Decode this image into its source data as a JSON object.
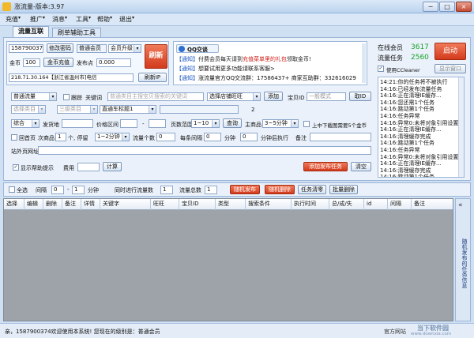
{
  "window": {
    "title": "涨流量-版本:3.97",
    "minimize": "−",
    "maximize": "□",
    "close": "×"
  },
  "menu": [
    "充值",
    "推广",
    "消息",
    "工具",
    "帮助",
    "退出"
  ],
  "tabs": [
    "流量互联",
    "刷单辅助工具"
  ],
  "account": {
    "id": "1587900374",
    "change_pwd": "修改密码",
    "member_type": "普通会员",
    "upgrade": "会员升级",
    "gold_label": "金币",
    "gold_value": "100",
    "gold_recharge": "金币充值",
    "points_label": "发布点",
    "points_value": "0.000",
    "refresh": "刷新",
    "ip": "218.71.30.164【浙江省温州市]电信",
    "refresh_ip": "刷新IP"
  },
  "qq": {
    "title": "QQ交谈",
    "notices": [
      {
        "tag": "【通知】",
        "pre": "付费会员每天请到",
        "red": "充值菜单里的礼包",
        "post": "领取金币!"
      },
      {
        "tag": "【通知】",
        "pre": "想要试用更多功能请联系客服>",
        "red": "",
        "post": ""
      },
      {
        "tag": "【通知】",
        "pre": "涨流量官方QQ交流群：17586437+  商家互助群：332616029",
        "red": "",
        "post": ""
      }
    ]
  },
  "stats": {
    "online_label": "在线会员",
    "online_value": "3617",
    "tasks_label": "流量任务",
    "tasks_value": "2560",
    "start": "启动",
    "ccleaner": "使用CCleaner",
    "show_window": "显示窗口"
  },
  "form": {
    "flow_type": "普通流量",
    "shop_check": "跟踪",
    "keyword_label": "关键词",
    "keyword_placeholder": "普通类目主搜宝贝搜索的关键词",
    "shop_select": "选择店铺旺旺",
    "add": "添加",
    "item_id_label": "宝贝ID",
    "item_id_placeholder": "一般模式",
    "get_id": "取ID",
    "cat1": "选择类目",
    "cat2": "三级类目",
    "title_label": "直通车标题1",
    "page_num": "2",
    "sort": "综合",
    "ship_label": "发货地",
    "price_label": "价格区间",
    "price_dash": "-",
    "pages_label": "页数范围",
    "pages_value": "1~10",
    "query": "查询",
    "main_label": "主商品",
    "main_value": "3~5分钟",
    "top_check": "上中下截图需要5个金币",
    "home_check": "回首页",
    "sub_label": "次商品",
    "sub_count": "1",
    "sub_unit": "个, 停留",
    "sub_stay": "1~2分钟",
    "flow_count_label": "流量个数",
    "flow_count": "0",
    "interval_label": "每条间隔",
    "interval_val": "0",
    "min_label": "分钟",
    "min_val": "0",
    "exec_label": "分钟后执行",
    "remark_label": "备注",
    "url_label": "站外页网址",
    "help_check": "显示帮助提示",
    "fee_label": "费用",
    "calc": "计算",
    "publish": "添加发布任务",
    "clear": "清空"
  },
  "log": [
    "14:21:你的任务将不被执行",
    "14:16:已经发布流量任务",
    "14:16:正在清理IE缓存...",
    "14:16:您还需1个任务",
    "14:16:跳动第1个任务",
    "14:16:任务异常",
    "14:16:异常0:未将对象引用设置",
    "14:16:正在清理IE缓存...",
    "14:16:清理缓存完成",
    "14:16:跳动第1个任务",
    "14:16:任务异常",
    "14:16:异常0:未将对象引用设置",
    "14:16:正在清理IE缓存...",
    "14:16:清理缓存完成",
    "14:16:跳动第1个任务",
    "14:16:1587900374登录"
  ],
  "list_toolbar": {
    "select_all": "全选",
    "interval": "间隔",
    "int_a": "0",
    "int_b": "1",
    "min": "分钟",
    "same_time": "同时进行流量数",
    "same_val": "1",
    "total_label": "流量总数",
    "total_val": "1",
    "random_pub": "随机发布",
    "random_del": "随机删除",
    "task_clear": "任务清零",
    "batch_del": "批量删除"
  },
  "table_headers": [
    "选择",
    "编辑",
    "删除",
    "备注",
    "详情",
    "关键字",
    "旺旺",
    "宝贝ID",
    "类型",
    "搜索条件",
    "执行时间",
    "总/成/失",
    "id",
    "间隔",
    "备注"
  ],
  "side_panel": {
    "toggle": "«",
    "text": "随机发布的任务信息"
  },
  "status": {
    "text": "亲，1587900374欢迎使用本系统! 您现在的级别是：普通会员",
    "right": "官方网站",
    "watermark": "当下软件园",
    "watermark_url": "www.downxia.com"
  }
}
